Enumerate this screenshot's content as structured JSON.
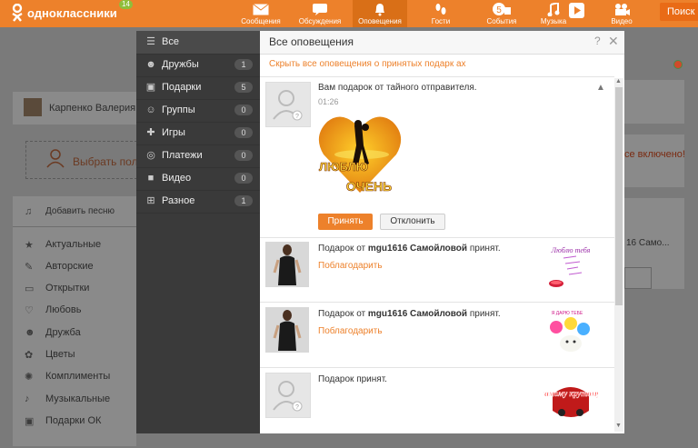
{
  "topbar": {
    "logo_text": "одноклассники",
    "logo_badge": "14",
    "nav": [
      {
        "label": "Сообщения",
        "icon": "envelope-icon"
      },
      {
        "label": "Обсуждения",
        "icon": "chat-icon"
      },
      {
        "label": "Оповещения",
        "icon": "bell-icon"
      },
      {
        "label": "Гости",
        "icon": "footprints-icon"
      },
      {
        "label": "События",
        "icon": "events-icon",
        "badge": "5"
      },
      {
        "label": "Музыка",
        "icon": "music-icon"
      },
      {
        "label": "Видео",
        "icon": "video-icon"
      }
    ],
    "search_label": "Поиск"
  },
  "background": {
    "user_name": "Карпенко Валерия",
    "choose_label": "Выбрать полу",
    "enabled_text": "се включено!",
    "friend_snippet": "16 Само...",
    "add_song": "Добавить песню",
    "categories": [
      "Актуальные",
      "Авторские",
      "Открытки",
      "Любовь",
      "Дружба",
      "Цветы",
      "Комплименты",
      "Музыкальные",
      "Подарки ОК"
    ]
  },
  "menu": {
    "items": [
      {
        "label": "Все",
        "icon": "list-icon",
        "count": ""
      },
      {
        "label": "Дружбы",
        "icon": "friends-icon",
        "count": "1"
      },
      {
        "label": "Подарки",
        "icon": "gift-icon",
        "count": "5"
      },
      {
        "label": "Группы",
        "icon": "groups-icon",
        "count": "0"
      },
      {
        "label": "Игры",
        "icon": "gamepad-icon",
        "count": "0"
      },
      {
        "label": "Платежи",
        "icon": "coin-icon",
        "count": "0"
      },
      {
        "label": "Видео",
        "icon": "camera-icon",
        "count": "0"
      },
      {
        "label": "Разное",
        "icon": "grid-icon",
        "count": "1"
      }
    ]
  },
  "panel": {
    "title": "Все оповещения",
    "help": "?",
    "close": "✕",
    "hide_link": "Скрыть все оповещения о принятых подарк ах",
    "notifications": [
      {
        "text": "Вам подарок от тайного отправителя.",
        "time": "01:26",
        "gift_line1": "ЛЮБЛЮ",
        "gift_line2": "ОЧЕНЬ",
        "accept": "Принять",
        "decline": "Отклонить"
      },
      {
        "prefix": "Подарок от ",
        "user": "mgu1616 Самойловой",
        "suffix": " принят.",
        "thanks": "Поблагодарить",
        "gift_text": "Люблю тебя"
      },
      {
        "prefix": "Подарок от ",
        "user": "mgu1616 Самойловой",
        "suffix": " принят.",
        "thanks": "Поблагодарить",
        "gift_text": "Я ДАРЮ ТЕБЕ"
      },
      {
        "text": "Подарок принят.",
        "gift_text": "самому крутому"
      }
    ]
  },
  "colors": {
    "brand": "#ed812b",
    "menu_bg": "#3a3a3a"
  }
}
